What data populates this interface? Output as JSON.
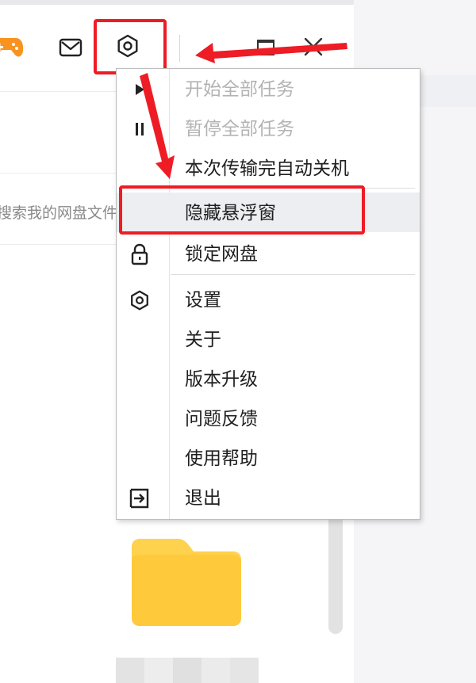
{
  "search": {
    "placeholder": "搜索我的网盘文件"
  },
  "menu": {
    "items": [
      {
        "label": "开始全部任务",
        "icon": "play-icon",
        "disabled": true
      },
      {
        "label": "暂停全部任务",
        "icon": "pause-icon",
        "disabled": true
      },
      {
        "label": "本次传输完自动关机",
        "icon": "",
        "disabled": false
      },
      {
        "label": "隐藏悬浮窗",
        "icon": "",
        "disabled": false,
        "highlighted": true
      },
      {
        "label": "锁定网盘",
        "icon": "lock-icon",
        "disabled": false
      },
      {
        "label": "设置",
        "icon": "gear-icon",
        "disabled": false
      },
      {
        "label": "关于",
        "icon": "",
        "disabled": false
      },
      {
        "label": "版本升级",
        "icon": "",
        "disabled": false
      },
      {
        "label": "问题反馈",
        "icon": "",
        "disabled": false
      },
      {
        "label": "使用帮助",
        "icon": "",
        "disabled": false
      },
      {
        "label": "退出",
        "icon": "exit-icon",
        "disabled": false
      }
    ]
  },
  "colors": {
    "annotation": "#ee1c25",
    "folder": "#ffd24d",
    "game_icon": "#f7931e",
    "menu_highlight": "#eceef1",
    "disabled_text": "#b3b3b3"
  },
  "icons": {
    "title_bar": [
      "game-controller-icon",
      "mail-icon",
      "gear-icon",
      "minimize-icon",
      "maximize-icon",
      "close-icon"
    ],
    "content": [
      "folder-icon"
    ]
  }
}
